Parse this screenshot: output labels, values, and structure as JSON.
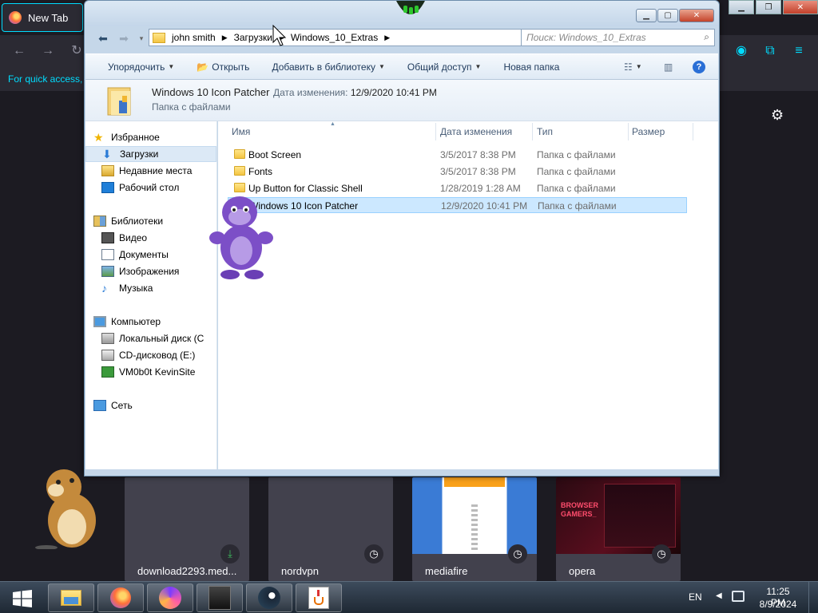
{
  "firefox": {
    "tab_title": "New Tab",
    "quick_access_text": "For quick access, p",
    "tiles": [
      {
        "label": "download2293.med...",
        "icon": "download-icon"
      },
      {
        "label": "nordvpn",
        "icon": "clock-icon"
      },
      {
        "label": "mediafire",
        "icon": "clock-icon"
      },
      {
        "label": "opera",
        "icon": "clock-icon"
      }
    ],
    "opera_thumb_text": "BROWSER\nGAMERS_"
  },
  "explorer": {
    "breadcrumb": [
      "john smith",
      "Загрузки",
      "Windows_10_Extras"
    ],
    "search_placeholder": "Поиск: Windows_10_Extras",
    "toolbar": {
      "organize": "Упорядочить",
      "open": "Открыть",
      "add_library": "Добавить в библиотеку",
      "share": "Общий доступ",
      "new_folder": "Новая папка"
    },
    "details": {
      "name": "Windows 10 Icon Patcher",
      "date_label": "Дата изменения:",
      "date_value": "12/9/2020 10:41 PM",
      "type": "Папка с файлами"
    },
    "nav": {
      "favorites": "Избранное",
      "downloads": "Загрузки",
      "recent": "Недавние места",
      "desktop": "Рабочий стол",
      "libraries": "Библиотеки",
      "video": "Видео",
      "documents": "Документы",
      "images": "Изображения",
      "music": "Музыка",
      "computer": "Компьютер",
      "local_disk": "Локальный диск (C",
      "cd_drive": "CD-дисковод (E:)",
      "vm_share": "VM0b0t KevinSite",
      "network": "Сеть"
    },
    "columns": {
      "name": "Имя",
      "date": "Дата изменения",
      "type": "Тип",
      "size": "Размер"
    },
    "files": [
      {
        "name": "Boot Screen",
        "date": "3/5/2017 8:38 PM",
        "type": "Папка с файлами"
      },
      {
        "name": "Fonts",
        "date": "3/5/2017 8:38 PM",
        "type": "Папка с файлами"
      },
      {
        "name": "Up Button for Classic Shell",
        "date": "1/28/2019 1:28 AM",
        "type": "Папка с файлами"
      },
      {
        "name": "Windows 10 Icon Patcher",
        "date": "12/9/2020 10:41 PM",
        "type": "Папка с файлами"
      }
    ],
    "selected_index": 3
  },
  "taskbar": {
    "lang": "EN",
    "time": "11:25 PM",
    "date": "8/9/2024"
  }
}
